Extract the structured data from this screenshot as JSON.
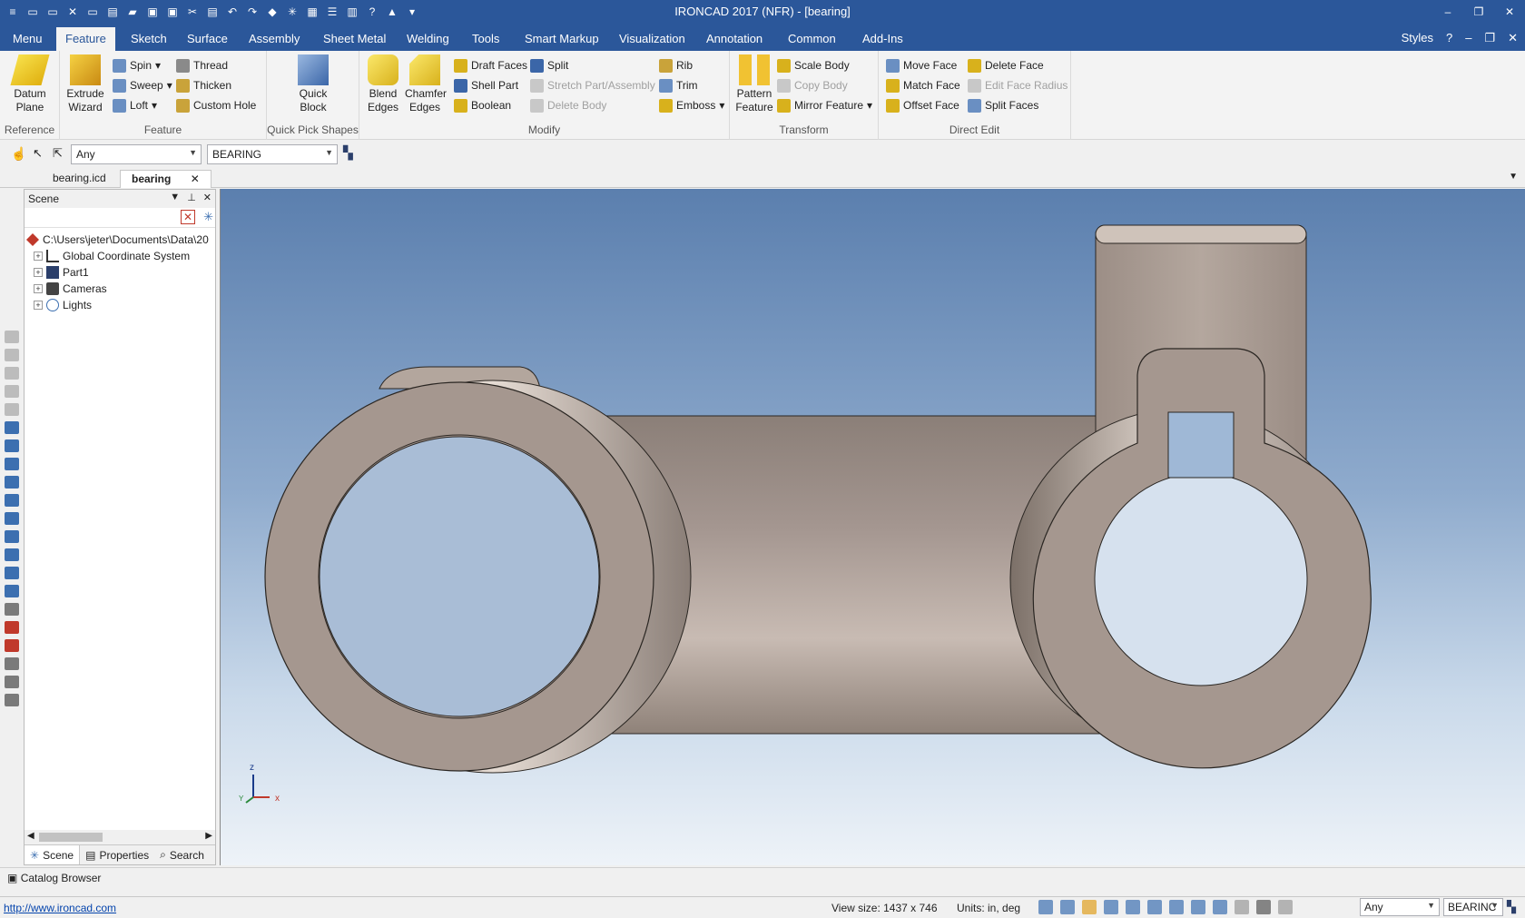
{
  "window": {
    "title": "IRONCAD 2017 (NFR) - [bearing]",
    "controls": [
      "–",
      "❐",
      "✕"
    ]
  },
  "ribbon_tabs": [
    "Menu",
    "Feature",
    "Sketch",
    "Surface",
    "Assembly",
    "Sheet Metal",
    "Welding",
    "Tools",
    "Smart Markup",
    "Visualization",
    "Annotation",
    "Common",
    "Add-Ins"
  ],
  "ribbon_right": {
    "styles": "Styles",
    "help": "?"
  },
  "ribbon": {
    "reference": {
      "label": "Reference",
      "datum_plane": "Datum Plane"
    },
    "feature": {
      "label": "Feature",
      "extrude_wizard": "Extrude Wizard",
      "spin": "Spin",
      "sweep": "Sweep",
      "loft": "Loft",
      "thread": "Thread",
      "thicken": "Thicken",
      "custom_hole": "Custom Hole"
    },
    "quick_pick": {
      "label": "Quick Pick Shapes",
      "quick_block": "Quick Block"
    },
    "modify": {
      "label": "Modify",
      "blend_edges": "Blend Edges",
      "chamfer_edges": "Chamfer Edges",
      "draft_faces": "Draft Faces",
      "shell_part": "Shell Part",
      "boolean": "Boolean",
      "split": "Split",
      "stretch": "Stretch Part/Assembly",
      "delete_body": "Delete Body",
      "rib": "Rib",
      "trim": "Trim",
      "emboss": "Emboss"
    },
    "transform": {
      "label": "Transform",
      "pattern_feature": "Pattern Feature",
      "scale_body": "Scale Body",
      "copy_body": "Copy Body",
      "mirror_feature": "Mirror Feature"
    },
    "direct_edit": {
      "label": "Direct Edit",
      "move_face": "Move Face",
      "match_face": "Match Face",
      "offset_face": "Offset Face",
      "delete_face": "Delete Face",
      "edit_face_radius": "Edit Face Radius",
      "split_faces": "Split Faces"
    }
  },
  "selection": {
    "filter": "Any",
    "scope": "BEARING"
  },
  "doc_tabs": [
    "bearing.icd",
    "bearing"
  ],
  "scene": {
    "title": "Scene",
    "tree": [
      {
        "label": "C:\\Users\\jeter\\Documents\\Data\\20"
      },
      {
        "label": "Global Coordinate System"
      },
      {
        "label": "Part1"
      },
      {
        "label": "Cameras"
      },
      {
        "label": "Lights"
      }
    ],
    "bottom_tabs": [
      "Scene",
      "Properties",
      "Search"
    ]
  },
  "triad": {
    "z": "z",
    "x": "x",
    "y": "Y"
  },
  "catalog": "Catalog Browser",
  "status": {
    "link": "http://www.ironcad.com",
    "view_size": "View size: 1437 x  746",
    "units": "Units: in, deg",
    "filter": "Any",
    "scope": "BEARINC"
  }
}
